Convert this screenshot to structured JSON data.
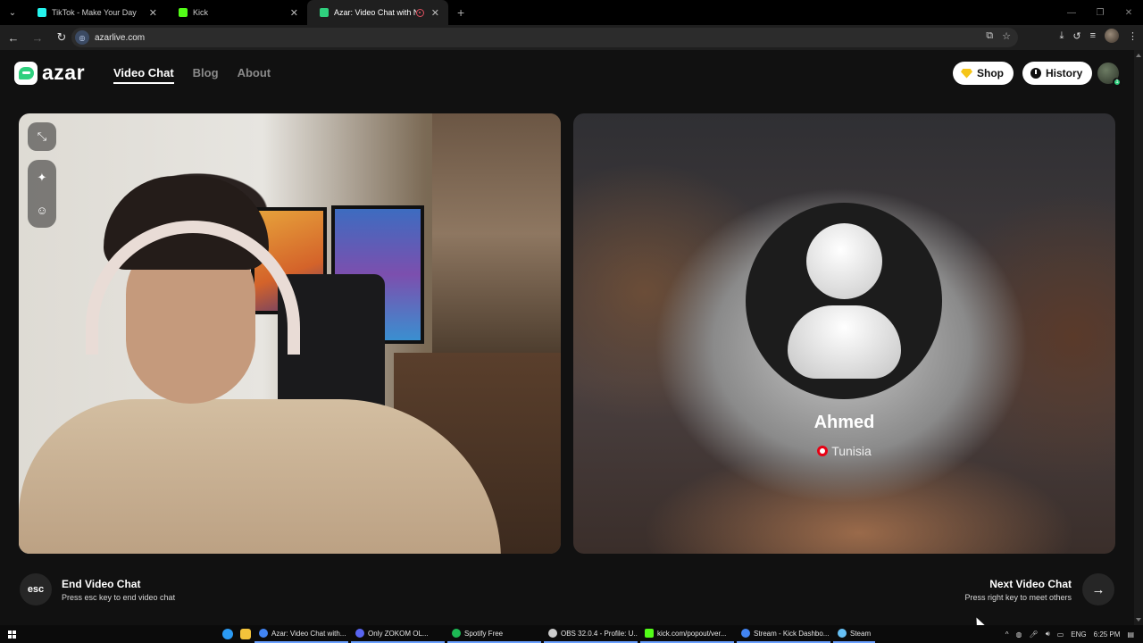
{
  "browser": {
    "tabs": [
      {
        "title": "TikTok - Make Your Day",
        "favicon": "tiktok-icon",
        "color": "#25f4ee",
        "active": false
      },
      {
        "title": "Kick",
        "favicon": "kick-icon",
        "color": "#53fc18",
        "active": false
      },
      {
        "title": "Azar: Video Chat with New",
        "favicon": "azar-icon",
        "color": "#2fd07e",
        "active": true
      }
    ],
    "url": "azarlive.com"
  },
  "site": {
    "logo_text": "azar",
    "nav": [
      {
        "label": "Video Chat",
        "active": true
      },
      {
        "label": "Blog",
        "active": false
      },
      {
        "label": "About",
        "active": false
      }
    ],
    "shop_label": "Shop",
    "history_label": "History",
    "avatar_badge": "1",
    "accent_color": "#2fd07e"
  },
  "remote": {
    "name": "Ahmed",
    "country": "Tunisia",
    "flag": "tunisia-flag-icon"
  },
  "controls": {
    "esc_key_label": "esc",
    "end_title": "End Video Chat",
    "end_sub": "Press esc key to end video chat",
    "next_title": "Next Video Chat",
    "next_sub": "Press right key to meet others"
  },
  "taskbar": {
    "tasks": [
      {
        "label": "Azar: Video Chat with...",
        "icon": "chrome-icon",
        "color": "#4285f4"
      },
      {
        "label": "Only ZOKOM OL...",
        "icon": "discord-icon",
        "color": "#5865f2"
      },
      {
        "label": "Spotify Free",
        "icon": "spotify-icon",
        "color": "#1db954"
      },
      {
        "label": "OBS 32.0.4 - Profile: U...",
        "icon": "obs-icon",
        "color": "#cccccc"
      },
      {
        "label": "kick.com/popout/ver...",
        "icon": "kick-icon",
        "color": "#53fc18"
      },
      {
        "label": "Stream - Kick Dashbo...",
        "icon": "chrome-icon",
        "color": "#4285f4"
      },
      {
        "label": "Steam",
        "icon": "steam-icon",
        "color": "#66c0f4"
      }
    ],
    "language": "ENG",
    "time": "6:25 PM"
  }
}
